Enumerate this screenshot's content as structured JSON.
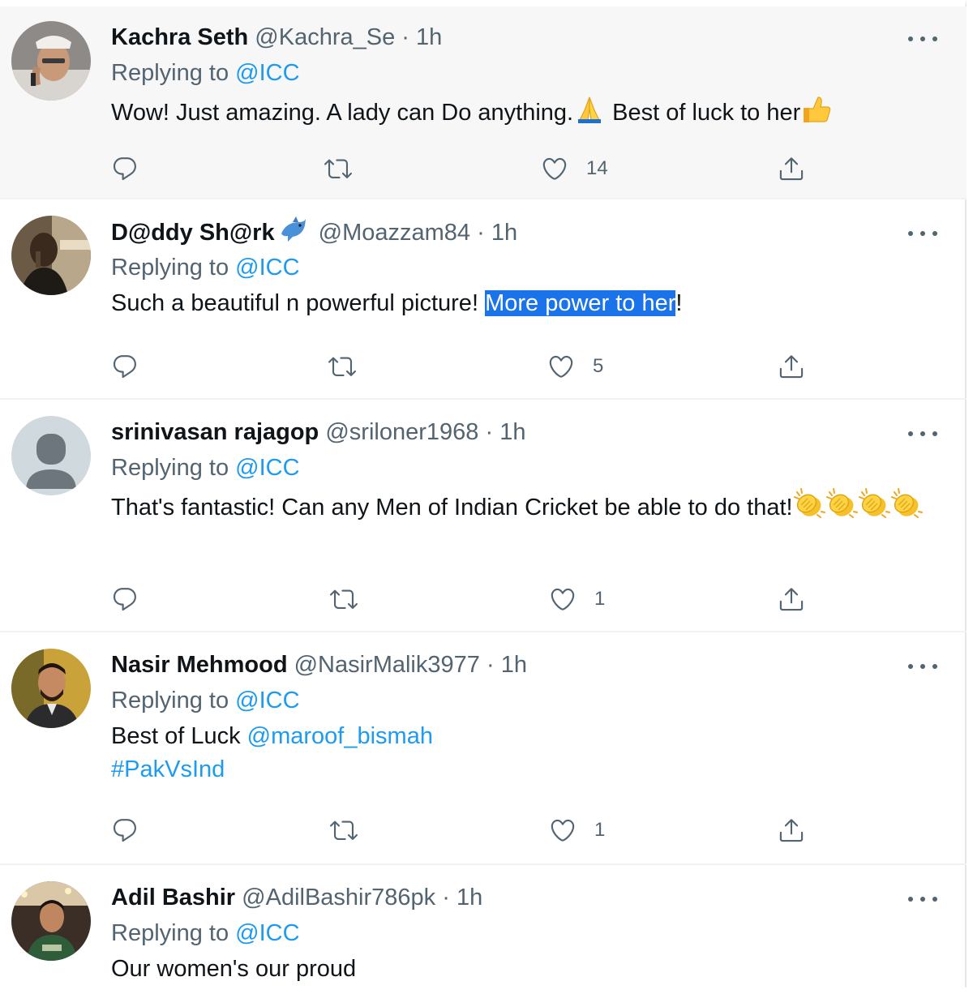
{
  "tweets": [
    {
      "name": "Kachra Seth",
      "handle": "@Kachra_Se",
      "dot": "·",
      "time": "1h",
      "replying_prefix": "Replying to ",
      "replying_to": "@ICC",
      "text_1": "Wow! Just amazing.  A lady can Do anything.",
      "text_2": " Best of luck to her",
      "emojis": [
        "folded-hands",
        "thumbs-up"
      ],
      "likes": "14"
    },
    {
      "name": "D@ddy Sh@rk",
      "name_badge": "dolphin",
      "handle": "@Moazzam84",
      "dot": "·",
      "time": "1h",
      "replying_prefix": "Replying to ",
      "replying_to": "@ICC",
      "text_1": "Such a beautiful n powerful picture! ",
      "text_selected": "More power to her",
      "text_2": "!",
      "likes": "5"
    },
    {
      "name": "srinivasan rajagop",
      "handle": "@sriloner1968",
      "dot": "·",
      "time": "1h",
      "replying_prefix": "Replying to ",
      "replying_to": "@ICC",
      "text_1": "That's fantastic! Can any Men of Indian Cricket be able to do that!",
      "emojis": [
        "clapping-hands",
        "clapping-hands",
        "clapping-hands",
        "clapping-hands"
      ],
      "likes": "1"
    },
    {
      "name": "Nasir Mehmood",
      "handle": "@NasirMalik3977",
      "dot": "·",
      "time": "1h",
      "replying_prefix": "Replying to ",
      "replying_to": "@ICC",
      "text_1": "Best of Luck ",
      "mention": "@maroof_bismah",
      "hashtag": "#PakVsInd",
      "likes": "1"
    },
    {
      "name": "Adil Bashir",
      "handle": "@AdilBashir786pk",
      "dot": "·",
      "time": "1h",
      "replying_prefix": "Replying to ",
      "replying_to": "@ICC",
      "text_1": "Our women's our proud"
    }
  ],
  "colors": {
    "link": "#1d9bf0",
    "secondary_text": "#536471",
    "selection": "#1a73e8",
    "hover_background": "#f7f7f7"
  },
  "icons": [
    "reply-icon",
    "retweet-icon",
    "like-icon",
    "share-icon",
    "more-icon"
  ]
}
